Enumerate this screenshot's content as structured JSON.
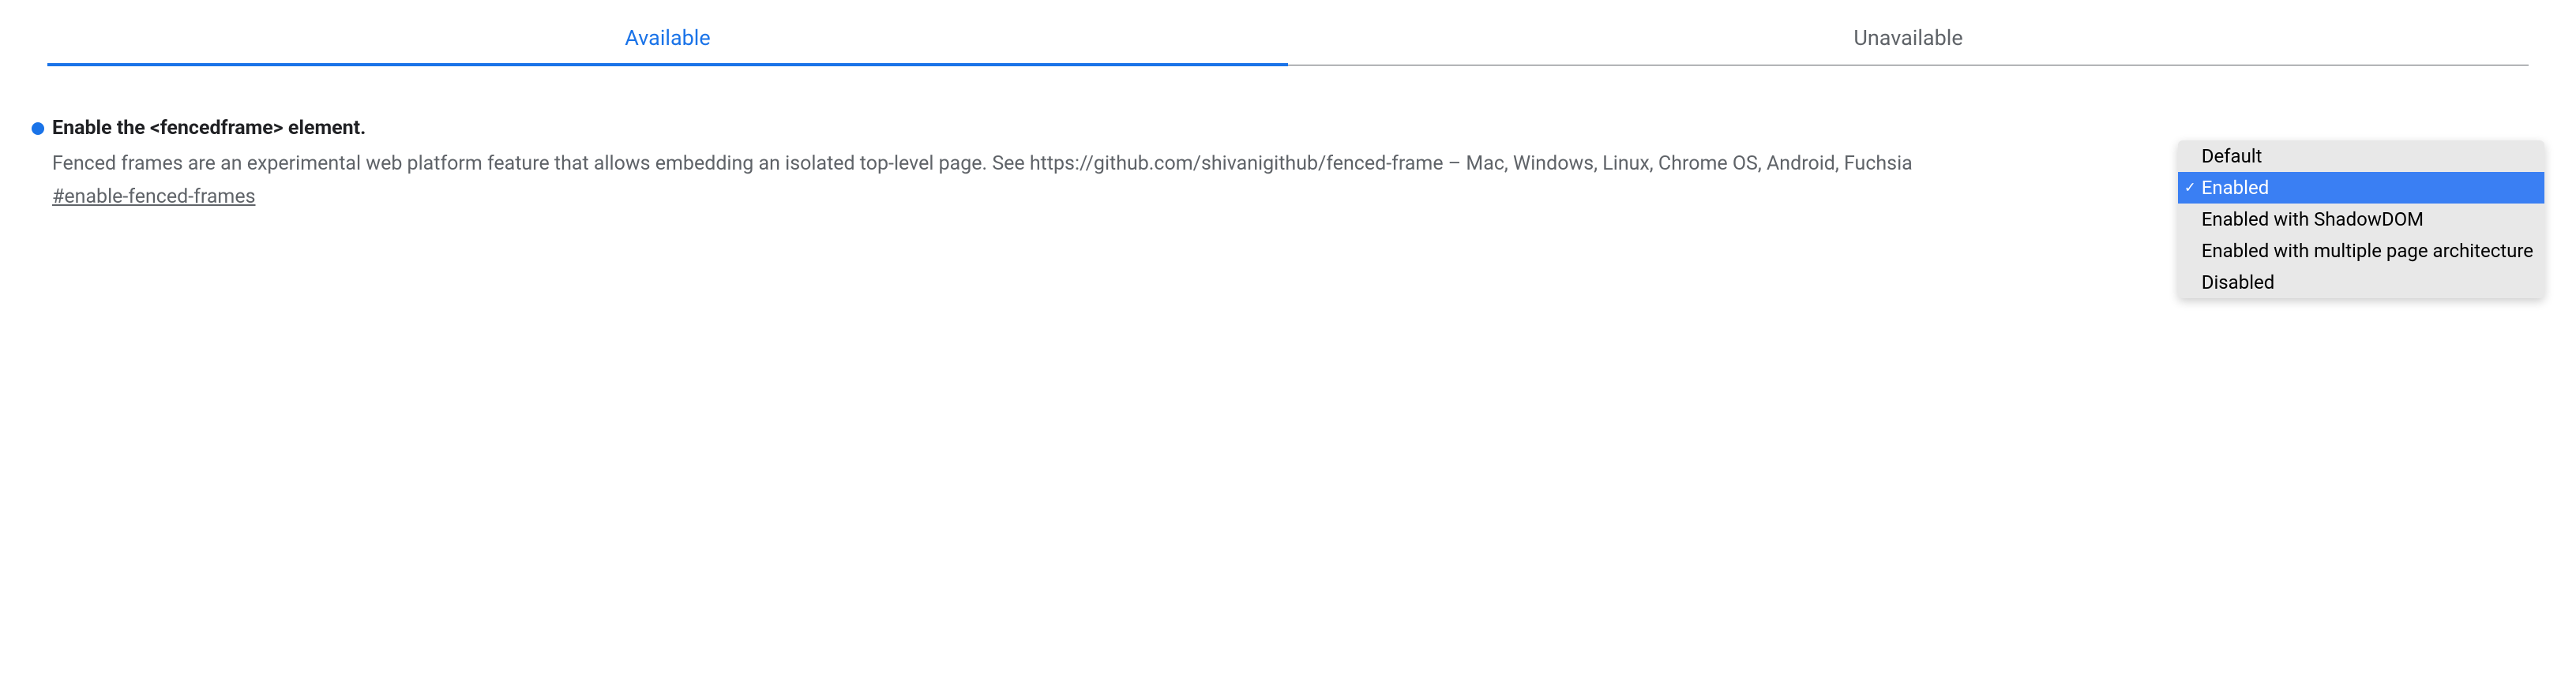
{
  "tabs": {
    "available": "Available",
    "unavailable": "Unavailable"
  },
  "flag": {
    "title": "Enable the <fencedframe> element.",
    "description": "Fenced frames are an experimental web platform feature that allows embedding an isolated top-level page. See https://github.com/shivanigithub/fenced-frame – Mac, Windows, Linux, Chrome OS, Android, Fuchsia",
    "hash": "#enable-fenced-frames"
  },
  "dropdown": {
    "options": [
      {
        "label": "Default",
        "selected": false
      },
      {
        "label": "Enabled",
        "selected": true
      },
      {
        "label": "Enabled with ShadowDOM",
        "selected": false
      },
      {
        "label": "Enabled with multiple page architecture",
        "selected": false
      },
      {
        "label": "Disabled",
        "selected": false
      }
    ]
  }
}
